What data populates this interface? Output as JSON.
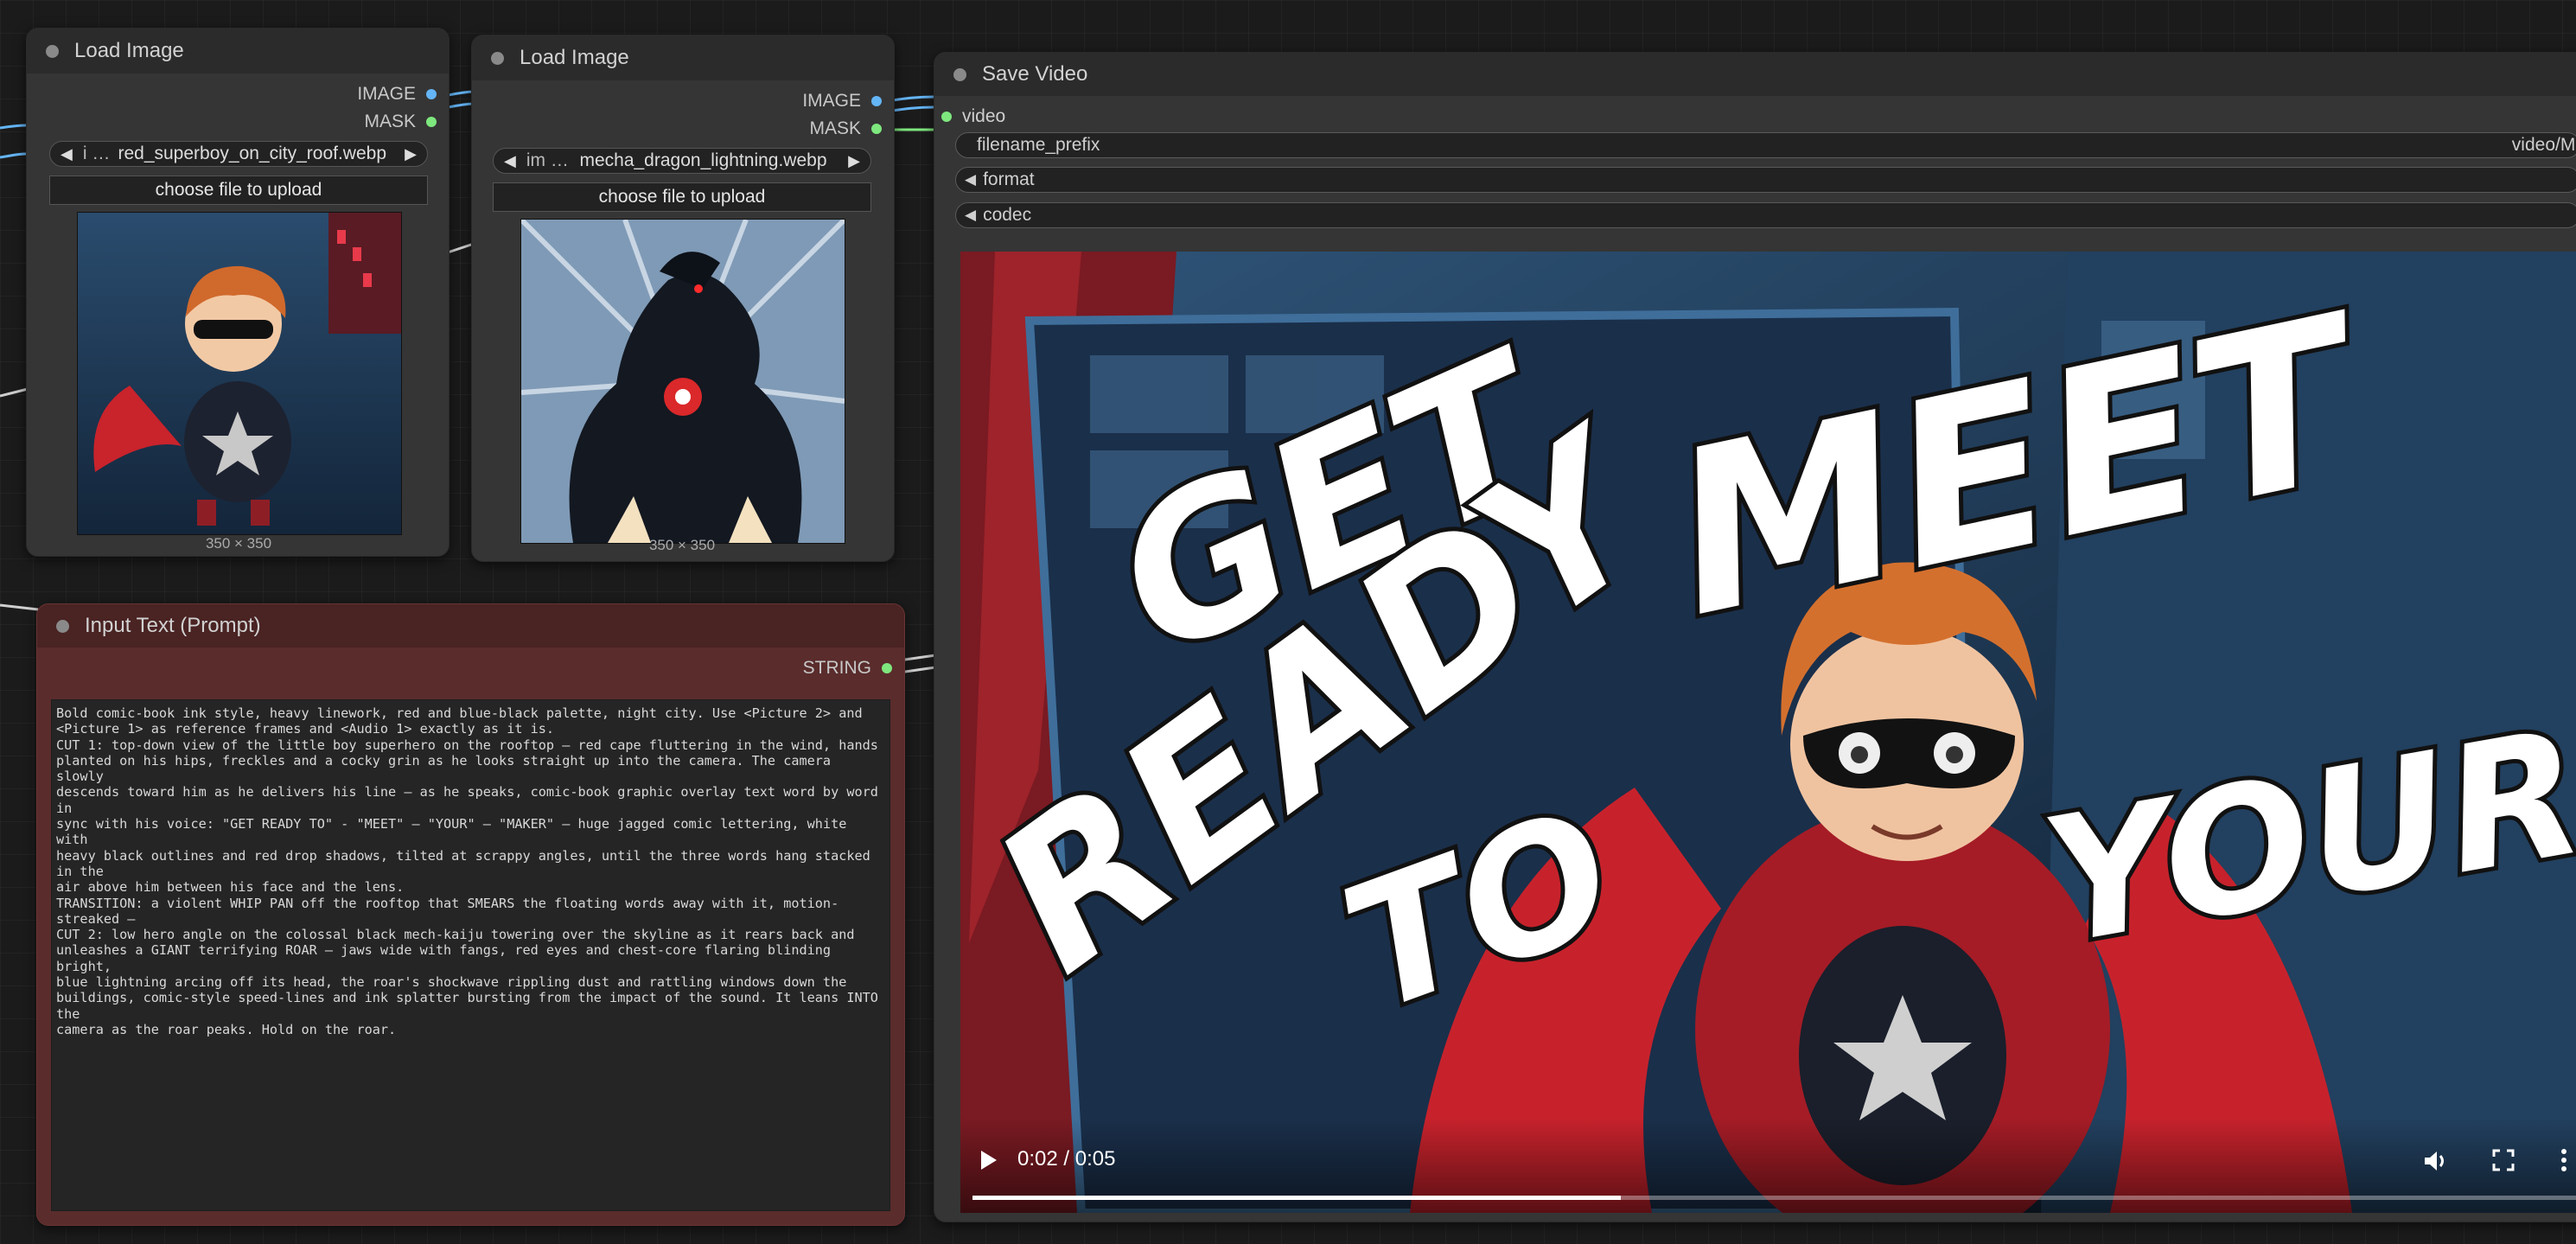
{
  "nodes": {
    "load_image_1": {
      "title": "Load Image",
      "outputs": [
        "IMAGE",
        "MASK"
      ],
      "image_combo": {
        "prefix": "i …",
        "filename": "red_superboy_on_city_roof.webp"
      },
      "upload_label": "choose file to upload",
      "dimensions": "350 × 350"
    },
    "load_image_2": {
      "title": "Load Image",
      "outputs": [
        "IMAGE",
        "MASK"
      ],
      "image_combo": {
        "prefix": "im …",
        "filename": "mecha_dragon_lightning.webp"
      },
      "upload_label": "choose file to upload",
      "dimensions": "350 × 350"
    },
    "input_text": {
      "title": "Input Text (Prompt)",
      "output": "STRING",
      "text": "Bold comic-book ink style, heavy linework, red and blue-black palette, night city. Use <Picture 2> and\n<Picture 1> as reference frames and <Audio 1> exactly as it is.\nCUT 1: top-down view of the little boy superhero on the rooftop — red cape fluttering in the wind, hands\nplanted on his hips, freckles and a cocky grin as he looks straight up into the camera. The camera slowly\ndescends toward him as he delivers his line — as he speaks, comic-book graphic overlay text word by word in\nsync with his voice: \"GET READY TO\" - \"MEET\" — \"YOUR\" — \"MAKER\" — huge jagged comic lettering, white with\nheavy black outlines and red drop shadows, tilted at scrappy angles, until the three words hang stacked in the\nair above him between his face and the lens.\nTRANSITION: a violent WHIP PAN off the rooftop that SMEARS the floating words away with it, motion-streaked —\nCUT 2: low hero angle on the colossal black mech-kaiju towering over the skyline as it rears back and\nunleashes a GIANT terrifying ROAR — jaws wide with fangs, red eyes and chest-core flaring blinding bright,\nblue lightning arcing off its head, the roar's shockwave rippling dust and rattling windows down the\nbuildings, comic-style speed-lines and ink splatter bursting from the impact of the sound. It leans INTO the\ncamera as the roar peaks. Hold on the roar."
    },
    "save_video": {
      "title": "Save Video",
      "input": "video",
      "widgets": {
        "filename_prefix_label": "filename_prefix",
        "filename_prefix_value": "video/Mi",
        "format_label": "format",
        "codec_label": "codec"
      },
      "player": {
        "overlay_words": [
          "GET",
          "READY",
          "TO",
          "MEET",
          "YOUR"
        ],
        "time": "0:02 / 0:05",
        "progress": 0.4
      }
    }
  },
  "icons": [
    "play-icon",
    "volume-icon",
    "fullscreen-icon",
    "more-options-icon"
  ],
  "colors": {
    "image_socket": "#64b5f6",
    "mask_socket": "#7ee87e",
    "prompt_node": "#5a2c2c"
  }
}
